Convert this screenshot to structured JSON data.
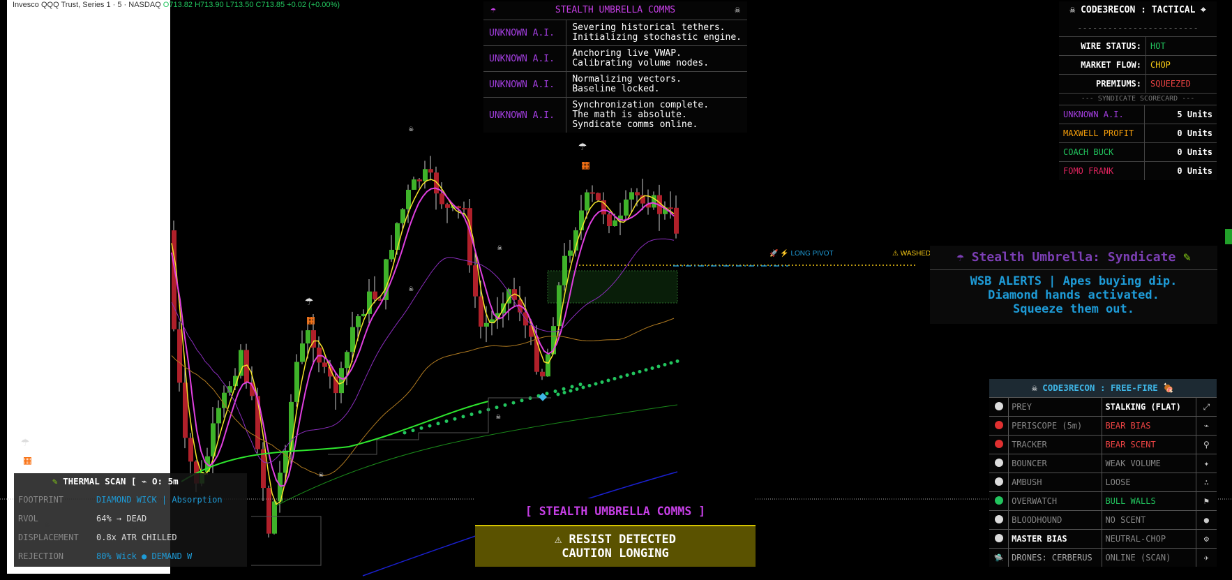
{
  "ticker": {
    "name": "Invesco QQQ Trust, Series 1 · 5 · NASDAQ",
    "ohlc": "O713.82  H713.90  L713.50  C713.85  +0.02 (+0.00%)"
  },
  "pivots": {
    "long_label": "LONG PIVOT",
    "washed_label": "WASHED PIVOT"
  },
  "comms_top": {
    "title": "STEALTH UMBRELLA COMMS",
    "rows": [
      {
        "source": "UNKNOWN A.I.",
        "message": "Severing historical tethers.\nInitializing stochastic engine."
      },
      {
        "source": "UNKNOWN A.I.",
        "message": "Anchoring live VWAP.\nCalibrating volume nodes."
      },
      {
        "source": "UNKNOWN A.I.",
        "message": "Normalizing vectors.\nBaseline locked."
      },
      {
        "source": "UNKNOWN A.I.",
        "message": "Synchronization complete.\nThe math is absolute.\nSyndicate comms online."
      }
    ]
  },
  "tactical": {
    "title": "CODE3RECON : TACTICAL",
    "dashes": "------------------------",
    "status": [
      {
        "key": "WIRE STATUS:",
        "value": "HOT",
        "color": "#22c55e"
      },
      {
        "key": "MARKET FLOW:",
        "value": "CHOP",
        "color": "#facc15"
      },
      {
        "key": "PREMIUMS:",
        "value": "SQUEEZED",
        "color": "#ef4444"
      }
    ],
    "scorecard_title": "--- SYNDICATE SCORECARD ---",
    "scorecard": [
      {
        "name": "UNKNOWN A.I.",
        "units": "5 Units",
        "color": "#a33ee0"
      },
      {
        "name": "MAXWELL PROFIT",
        "units": "0 Units",
        "color": "#f59e0b"
      },
      {
        "name": "COACH BUCK",
        "units": "0 Units",
        "color": "#22c55e"
      },
      {
        "name": "FOMO FRANK",
        "units": "0 Units",
        "color": "#e0245e"
      }
    ]
  },
  "syndicate": {
    "title": "Stealth Umbrella: Syndicate",
    "body": "WSB ALERTS | Apes buying dip.\nDiamond hands activated.\nSqueeze them out."
  },
  "freefire": {
    "title": "CODE3RECON : FREE-FIRE",
    "rows": [
      {
        "name": "PREY",
        "value": "STALKING (FLAT)",
        "dot": "#dddddd",
        "color": "#ffffff",
        "icon": "⤢",
        "icon_name": "crosshair-icon",
        "bold": false
      },
      {
        "name": "PERISCOPE (5m)",
        "value": "BEAR BIAS",
        "dot": "#e03030",
        "color": "#ef4444",
        "icon": "⌁",
        "icon_name": "periscope-icon",
        "bold": false
      },
      {
        "name": "TRACKER",
        "value": "BEAR SCENT",
        "dot": "#e03030",
        "color": "#ef4444",
        "icon": "⚲",
        "icon_name": "squirrel-icon",
        "bold": false
      },
      {
        "name": "BOUNCER",
        "value": "WEAK VOLUME",
        "dot": "#dddddd",
        "color": "#888888",
        "icon": "✦",
        "icon_name": "wolf-icon",
        "bold": false
      },
      {
        "name": "AMBUSH",
        "value": "LOOSE",
        "dot": "#dddddd",
        "color": "#888888",
        "icon": "∴",
        "icon_name": "paw-icon",
        "bold": false
      },
      {
        "name": "OVERWATCH",
        "value": "BULL WALLS",
        "dot": "#22c55e",
        "color": "#22c55e",
        "icon": "⚑",
        "icon_name": "scope-icon",
        "bold": false
      },
      {
        "name": "BLOODHOUND",
        "value": "NO SCENT",
        "dot": "#dddddd",
        "color": "#888888",
        "icon": "●",
        "icon_name": "blood-drop-icon",
        "bold": false
      },
      {
        "name": "MASTER BIAS",
        "value": "NEUTRAL-CHOP",
        "dot": "#dddddd",
        "color": "#888888",
        "icon": "⚙",
        "icon_name": "gear-icon",
        "bold": true
      },
      {
        "name": "DRONES: CERBERUS",
        "value": "ONLINE (SCAN)",
        "dot": "",
        "color": "#888888",
        "icon": "✈",
        "icon_name": "drone-icon",
        "bold": false
      }
    ]
  },
  "thermal": {
    "title": "THERMAL SCAN [",
    "title_mid": "O: 5m",
    "rows": [
      {
        "key": "FOOTPRINT",
        "value": "DIAMOND WICK | Absorption",
        "value_color": "#1e9bd7"
      },
      {
        "key": "RVOL",
        "value": "64%  →  DEAD",
        "value_color": "#dddddd"
      },
      {
        "key": "DISPLACEMENT",
        "value": "0.8x ATR   CHILLED",
        "value_color": "#dddddd"
      },
      {
        "key": "REJECTION",
        "value": "80% Wick  ● DEMAND W",
        "value_color": "#1e9bd7"
      }
    ]
  },
  "comms_bottom": {
    "title": "[  STEALTH UMBRELLA COMMS   ]",
    "line1": "⚠ RESIST DETECTED",
    "line2": "CAUTION LONGING"
  }
}
